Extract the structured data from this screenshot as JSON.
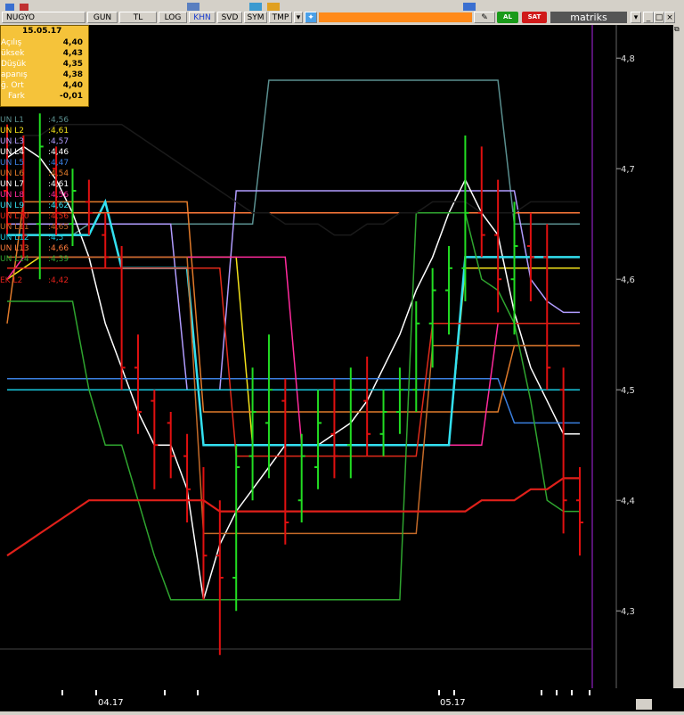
{
  "toolbar": {
    "symbol": "NUGYO",
    "buttons": [
      "GUN",
      "TL",
      "LOG",
      "KHN",
      "SVD",
      "SYM",
      "TMP"
    ],
    "selected_button": "KHN",
    "buy_label": "AL",
    "sell_label": "SAT",
    "brand": "matriks"
  },
  "info_box": {
    "date": "15.05.17",
    "rows": [
      {
        "label": "Açılış",
        "value": "4,40"
      },
      {
        "label": "üksek",
        "value": "4,43"
      },
      {
        "label": "Düşük",
        "value": "4,35"
      },
      {
        "label": "apanış",
        "value": "4,38"
      },
      {
        "label": "ğ. Ort",
        "value": "4,40"
      },
      {
        "label": "Fark",
        "value": "-0,01"
      }
    ]
  },
  "indicator_legend": [
    {
      "label": "UN L1",
      "value": ":4,56",
      "color": "#5a8f8f"
    },
    {
      "label": "UN L2",
      "value": ":4,61",
      "color": "#f2e11a"
    },
    {
      "label": "UN L3",
      "value": ":4,57",
      "color": "#b19cff"
    },
    {
      "label": "UN L4",
      "value": ":4,46",
      "color": "#ffffff"
    },
    {
      "label": "UN L5",
      "value": ":4,47",
      "color": "#3a7fe0"
    },
    {
      "label": "UN L6",
      "value": ":4,54",
      "color": "#e07a2a"
    },
    {
      "label": "UN L7",
      "value": ":4,61",
      "color": "#ffffff"
    },
    {
      "label": "UN L8",
      "value": ":4,56",
      "color": "#ff2a9c"
    },
    {
      "label": "UN L9",
      "value": ":4,62",
      "color": "#33e0f0"
    },
    {
      "label": "UN L10",
      "value": ":4,56",
      "color": "#e02a1a"
    },
    {
      "label": "UN L11",
      "value": ":4,65",
      "color": "#c46a28"
    },
    {
      "label": "UN L12",
      "value": ":4,5",
      "color": "#19c9e0"
    },
    {
      "label": "UN L13",
      "value": ":4,66",
      "color": "#ff7a3a"
    },
    {
      "label": "UN L14",
      "value": ":4,39",
      "color": "#2fa52f"
    },
    {
      "label": "EK L2",
      "value": ":4,42",
      "color": "#e0201a"
    }
  ],
  "chart_data": {
    "type": "candlestick",
    "symbol": "NUGYO",
    "y_ticks": [
      "4,8",
      "4,7",
      "4,6",
      "4,5",
      "4,4",
      "4,3"
    ],
    "ylim": [
      4.23,
      4.83
    ],
    "x_labels": [
      "04.17",
      "05.17"
    ],
    "grid": false,
    "background": "#000000",
    "up_color": "#22dd22",
    "down_color": "#e01010",
    "bars": [
      {
        "o": 4.68,
        "h": 4.74,
        "l": 4.64,
        "c": 4.65
      },
      {
        "o": 4.66,
        "h": 4.73,
        "l": 4.62,
        "c": 4.64
      },
      {
        "o": 4.65,
        "h": 4.75,
        "l": 4.6,
        "c": 4.72
      },
      {
        "o": 4.7,
        "h": 4.72,
        "l": 4.64,
        "c": 4.66
      },
      {
        "o": 4.65,
        "h": 4.7,
        "l": 4.63,
        "c": 4.68
      },
      {
        "o": 4.67,
        "h": 4.69,
        "l": 4.64,
        "c": 4.66
      },
      {
        "o": 4.64,
        "h": 4.66,
        "l": 4.61,
        "c": 4.62
      },
      {
        "o": 4.61,
        "h": 4.63,
        "l": 4.5,
        "c": 4.52
      },
      {
        "o": 4.52,
        "h": 4.55,
        "l": 4.46,
        "c": 4.48
      },
      {
        "o": 4.49,
        "h": 4.5,
        "l": 4.41,
        "c": 4.45
      },
      {
        "o": 4.47,
        "h": 4.48,
        "l": 4.42,
        "c": 4.44
      },
      {
        "o": 4.44,
        "h": 4.46,
        "l": 4.38,
        "c": 4.41
      },
      {
        "o": 4.4,
        "h": 4.43,
        "l": 4.31,
        "c": 4.35
      },
      {
        "o": 4.35,
        "h": 4.4,
        "l": 4.26,
        "c": 4.33
      },
      {
        "o": 4.33,
        "h": 4.45,
        "l": 4.3,
        "c": 4.43
      },
      {
        "o": 4.44,
        "h": 4.52,
        "l": 4.4,
        "c": 4.48
      },
      {
        "o": 4.47,
        "h": 4.55,
        "l": 4.42,
        "c": 4.5
      },
      {
        "o": 4.49,
        "h": 4.51,
        "l": 4.36,
        "c": 4.38
      },
      {
        "o": 4.4,
        "h": 4.46,
        "l": 4.38,
        "c": 4.44
      },
      {
        "o": 4.43,
        "h": 4.5,
        "l": 4.41,
        "c": 4.47
      },
      {
        "o": 4.46,
        "h": 4.51,
        "l": 4.42,
        "c": 4.44
      },
      {
        "o": 4.45,
        "h": 4.52,
        "l": 4.42,
        "c": 4.5
      },
      {
        "o": 4.49,
        "h": 4.53,
        "l": 4.44,
        "c": 4.46
      },
      {
        "o": 4.46,
        "h": 4.5,
        "l": 4.44,
        "c": 4.48
      },
      {
        "o": 4.48,
        "h": 4.52,
        "l": 4.46,
        "c": 4.5
      },
      {
        "o": 4.5,
        "h": 4.58,
        "l": 4.48,
        "c": 4.56
      },
      {
        "o": 4.56,
        "h": 4.61,
        "l": 4.52,
        "c": 4.59
      },
      {
        "o": 4.59,
        "h": 4.63,
        "l": 4.55,
        "c": 4.61
      },
      {
        "o": 4.61,
        "h": 4.73,
        "l": 4.58,
        "c": 4.66
      },
      {
        "o": 4.66,
        "h": 4.72,
        "l": 4.62,
        "c": 4.64
      },
      {
        "o": 4.64,
        "h": 4.69,
        "l": 4.57,
        "c": 4.6
      },
      {
        "o": 4.6,
        "h": 4.67,
        "l": 4.55,
        "c": 4.63
      },
      {
        "o": 4.63,
        "h": 4.66,
        "l": 4.58,
        "c": 4.62
      },
      {
        "o": 4.62,
        "h": 4.65,
        "l": 4.5,
        "c": 4.52
      },
      {
        "o": 4.5,
        "h": 4.52,
        "l": 4.37,
        "c": 4.4
      },
      {
        "o": 4.4,
        "h": 4.43,
        "l": 4.35,
        "c": 4.38
      }
    ],
    "series": [
      {
        "color": "#5a8f8f",
        "width": 1.5,
        "y": [
          4.64,
          4.64,
          4.64,
          4.64,
          4.64,
          4.65,
          4.65,
          4.65,
          4.65,
          4.65,
          4.65,
          4.65,
          4.65,
          4.65,
          4.65,
          4.65,
          4.78,
          4.78,
          4.78,
          4.78,
          4.78,
          4.78,
          4.78,
          4.78,
          4.78,
          4.78,
          4.78,
          4.78,
          4.78,
          4.78,
          4.78,
          4.65,
          4.65,
          4.65,
          4.65,
          4.65
        ]
      },
      {
        "color": "#f2e11a",
        "width": 1.5,
        "y": [
          4.6,
          4.61,
          4.62,
          4.62,
          4.62,
          4.62,
          4.62,
          4.62,
          4.62,
          4.62,
          4.62,
          4.62,
          4.62,
          4.62,
          4.62,
          4.45,
          4.45,
          4.45,
          4.45,
          4.45,
          4.45,
          4.45,
          4.45,
          4.45,
          4.45,
          4.45,
          4.45,
          4.45,
          4.61,
          4.61,
          4.61,
          4.61,
          4.61,
          4.61,
          4.61,
          4.61
        ]
      },
      {
        "color": "#b19cff",
        "width": 1.5,
        "y": [
          4.65,
          4.65,
          4.65,
          4.65,
          4.65,
          4.65,
          4.65,
          4.65,
          4.65,
          4.65,
          4.65,
          4.5,
          4.5,
          4.5,
          4.68,
          4.68,
          4.68,
          4.68,
          4.68,
          4.68,
          4.68,
          4.68,
          4.68,
          4.68,
          4.68,
          4.68,
          4.68,
          4.68,
          4.68,
          4.68,
          4.68,
          4.68,
          4.6,
          4.58,
          4.57,
          4.57
        ]
      },
      {
        "color": "#ffffff",
        "width": 1.5,
        "y": [
          4.71,
          4.72,
          4.71,
          4.69,
          4.66,
          4.62,
          4.56,
          4.52,
          4.48,
          4.45,
          4.45,
          4.41,
          4.31,
          4.36,
          4.39,
          4.41,
          4.43,
          4.45,
          4.45,
          4.45,
          4.46,
          4.47,
          4.49,
          4.52,
          4.55,
          4.59,
          4.62,
          4.66,
          4.69,
          4.66,
          4.64,
          4.57,
          4.52,
          4.49,
          4.46,
          4.46
        ]
      },
      {
        "color": "#3a7fe0",
        "width": 1.5,
        "y": [
          4.51,
          4.51,
          4.51,
          4.51,
          4.51,
          4.51,
          4.51,
          4.51,
          4.51,
          4.51,
          4.51,
          4.51,
          4.51,
          4.51,
          4.51,
          4.51,
          4.51,
          4.51,
          4.51,
          4.51,
          4.51,
          4.51,
          4.51,
          4.51,
          4.51,
          4.51,
          4.51,
          4.51,
          4.51,
          4.51,
          4.51,
          4.47,
          4.47,
          4.47,
          4.47,
          4.47
        ]
      },
      {
        "color": "#e07a2a",
        "width": 1.5,
        "y": [
          4.56,
          4.67,
          4.67,
          4.67,
          4.67,
          4.67,
          4.67,
          4.67,
          4.67,
          4.67,
          4.67,
          4.67,
          4.48,
          4.48,
          4.48,
          4.48,
          4.48,
          4.48,
          4.48,
          4.48,
          4.48,
          4.48,
          4.48,
          4.48,
          4.48,
          4.48,
          4.48,
          4.48,
          4.48,
          4.48,
          4.48,
          4.54,
          4.54,
          4.54,
          4.54,
          4.54
        ]
      },
      {
        "color": "#ff2a9c",
        "width": 1.5,
        "y": [
          4.6,
          4.62,
          4.62,
          4.62,
          4.62,
          4.62,
          4.62,
          4.62,
          4.62,
          4.62,
          4.62,
          4.62,
          4.62,
          4.62,
          4.62,
          4.62,
          4.62,
          4.62,
          4.45,
          4.45,
          4.45,
          4.45,
          4.45,
          4.45,
          4.45,
          4.45,
          4.45,
          4.45,
          4.45,
          4.45,
          4.56,
          4.56,
          4.56,
          4.56,
          4.56,
          4.56
        ]
      },
      {
        "color": "#33e0f0",
        "width": 2.5,
        "y": [
          4.64,
          4.64,
          4.64,
          4.64,
          4.64,
          4.64,
          4.67,
          4.61,
          4.61,
          4.61,
          4.61,
          4.61,
          4.45,
          4.45,
          4.45,
          4.45,
          4.45,
          4.45,
          4.45,
          4.45,
          4.45,
          4.45,
          4.45,
          4.45,
          4.45,
          4.45,
          4.45,
          4.45,
          4.62,
          4.62,
          4.62,
          4.62,
          4.62,
          4.62,
          4.62,
          4.62
        ]
      },
      {
        "color": "#e02a1a",
        "width": 1.5,
        "y": [
          4.61,
          4.61,
          4.61,
          4.61,
          4.61,
          4.61,
          4.61,
          4.61,
          4.61,
          4.61,
          4.61,
          4.61,
          4.61,
          4.61,
          4.44,
          4.44,
          4.44,
          4.44,
          4.44,
          4.44,
          4.44,
          4.44,
          4.44,
          4.44,
          4.44,
          4.44,
          4.56,
          4.56,
          4.56,
          4.56,
          4.56,
          4.56,
          4.56,
          4.56,
          4.56,
          4.56
        ]
      },
      {
        "color": "#c46a28",
        "width": 1.5,
        "y": [
          4.62,
          4.62,
          4.62,
          4.62,
          4.62,
          4.62,
          4.62,
          4.62,
          4.62,
          4.62,
          4.62,
          4.62,
          4.37,
          4.37,
          4.37,
          4.37,
          4.37,
          4.37,
          4.37,
          4.37,
          4.37,
          4.37,
          4.37,
          4.37,
          4.37,
          4.37,
          4.54,
          4.54,
          4.54,
          4.54,
          4.54,
          4.54,
          4.54,
          4.54,
          4.54,
          4.54
        ]
      },
      {
        "color": "#19c9e0",
        "width": 1.5,
        "y": [
          4.5,
          4.5,
          4.5,
          4.5,
          4.5,
          4.5,
          4.5,
          4.5,
          4.5,
          4.5,
          4.5,
          4.5,
          4.5,
          4.5,
          4.5,
          4.5,
          4.5,
          4.5,
          4.5,
          4.5,
          4.5,
          4.5,
          4.5,
          4.5,
          4.5,
          4.5,
          4.5,
          4.5,
          4.5,
          4.5,
          4.5,
          4.5,
          4.5,
          4.5,
          4.5,
          4.5
        ]
      },
      {
        "color": "#ff7a3a",
        "width": 1.5,
        "y": [
          4.66,
          4.66,
          4.66,
          4.66,
          4.66,
          4.66,
          4.66,
          4.66,
          4.66,
          4.66,
          4.66,
          4.66,
          4.66,
          4.66,
          4.66,
          4.66,
          4.66,
          4.66,
          4.66,
          4.66,
          4.66,
          4.66,
          4.66,
          4.66,
          4.66,
          4.66,
          4.66,
          4.66,
          4.66,
          4.66,
          4.66,
          4.66,
          4.66,
          4.66,
          4.66,
          4.66
        ]
      },
      {
        "color": "#2fa52f",
        "width": 1.5,
        "y": [
          4.58,
          4.58,
          4.58,
          4.58,
          4.58,
          4.5,
          4.45,
          4.45,
          4.4,
          4.35,
          4.31,
          4.31,
          4.31,
          4.31,
          4.31,
          4.31,
          4.31,
          4.31,
          4.31,
          4.31,
          4.31,
          4.31,
          4.31,
          4.31,
          4.31,
          4.66,
          4.66,
          4.66,
          4.66,
          4.6,
          4.59,
          4.56,
          4.49,
          4.4,
          4.39,
          4.39
        ]
      },
      {
        "color": "#e0201a",
        "width": 2.2,
        "y": [
          4.35,
          4.36,
          4.37,
          4.38,
          4.39,
          4.4,
          4.4,
          4.4,
          4.4,
          4.4,
          4.4,
          4.4,
          4.4,
          4.39,
          4.39,
          4.39,
          4.39,
          4.39,
          4.39,
          4.39,
          4.39,
          4.39,
          4.39,
          4.39,
          4.39,
          4.39,
          4.39,
          4.39,
          4.39,
          4.4,
          4.4,
          4.4,
          4.41,
          4.41,
          4.42,
          4.42
        ]
      },
      {
        "color": "#1a1a1a",
        "width": 1.5,
        "y": [
          4.72,
          4.73,
          4.73,
          4.74,
          4.74,
          4.74,
          4.74,
          4.74,
          4.73,
          4.72,
          4.71,
          4.7,
          4.69,
          4.68,
          4.67,
          4.66,
          4.66,
          4.65,
          4.65,
          4.65,
          4.64,
          4.64,
          4.65,
          4.65,
          4.66,
          4.66,
          4.67,
          4.67,
          4.67,
          4.66,
          4.66,
          4.66,
          4.67,
          4.67,
          4.67,
          4.67
        ]
      }
    ]
  }
}
